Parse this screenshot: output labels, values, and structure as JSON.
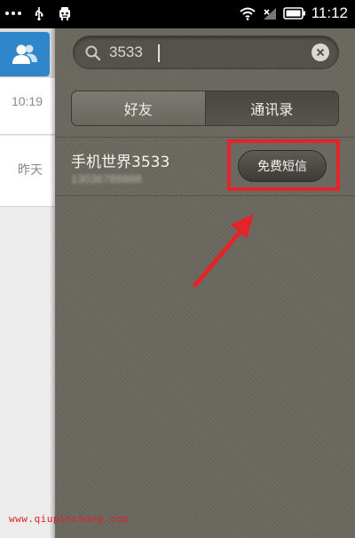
{
  "status_bar": {
    "time": "11:12",
    "icons": [
      "more-dots-icon",
      "usb-icon",
      "robot-icon",
      "wifi-icon",
      "signal-icon",
      "battery-icon"
    ]
  },
  "left_panel": {
    "tab_icon": "contacts-icon",
    "rows": [
      {
        "time": "10:19"
      },
      {
        "time": "昨天"
      }
    ]
  },
  "search": {
    "query": "3533",
    "icon": "search-icon",
    "clear_icon": "clear-icon"
  },
  "tabs": [
    {
      "label": "好友",
      "selected": false
    },
    {
      "label": "通讯录",
      "selected": true
    }
  ],
  "result": {
    "name": "手机世界3533",
    "phone": "13036788888",
    "action_label": "免费短信"
  },
  "annotation": {
    "highlight_color": "#e3242b"
  },
  "watermark": "www.qiupinchang.com"
}
